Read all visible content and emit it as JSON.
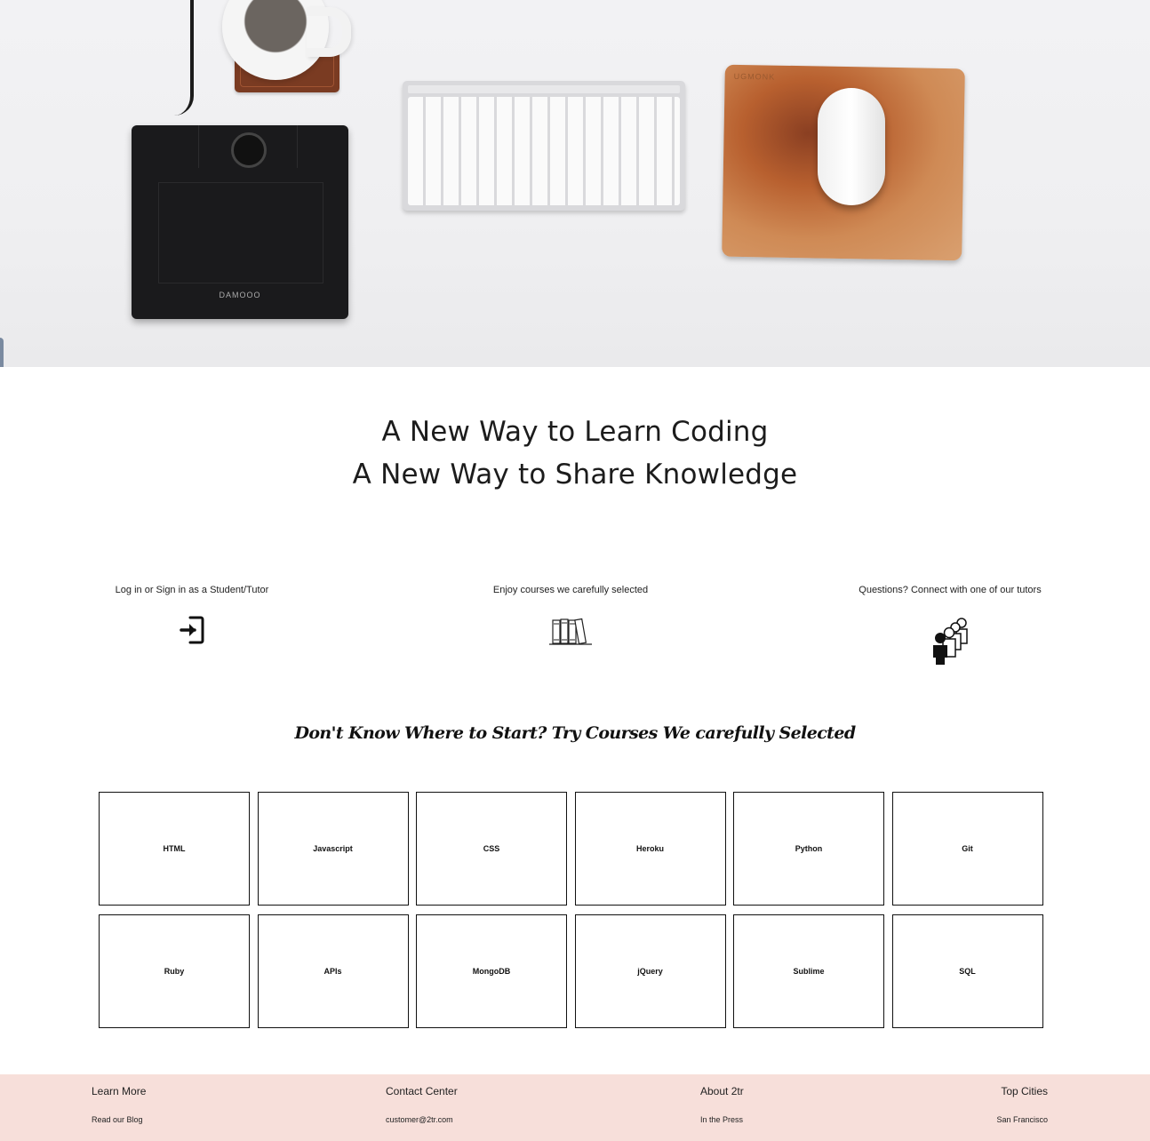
{
  "hero": {
    "tablet_brand": "DAMOOO",
    "mousepad_label": "UGMONK"
  },
  "headline": {
    "line1": "A New Way to Learn Coding",
    "line2": "A New Way to Share Knowledge"
  },
  "features": [
    {
      "text": "Log in or Sign in as a Student/Tutor",
      "icon": "login-icon"
    },
    {
      "text": "Enjoy courses we carefully selected",
      "icon": "books-icon"
    },
    {
      "text": "Questions? Connect with one of our tutors",
      "icon": "people-icon"
    }
  ],
  "courses_heading": "Don't Know Where to Start? Try Courses We carefully Selected",
  "courses": [
    "HTML",
    "Javascript",
    "CSS",
    "Heroku",
    "Python",
    "Git",
    "Ruby",
    "APIs",
    "MongoDB",
    "jQuery",
    "Sublime",
    "SQL"
  ],
  "footer": {
    "columns": [
      {
        "heading": "Learn More",
        "link": "Read our Blog"
      },
      {
        "heading": "Contact Center",
        "link": "customer@2tr.com"
      },
      {
        "heading": "About 2tr",
        "link": "In the Press"
      },
      {
        "heading": "Top Cities",
        "link": "San Francisco"
      }
    ],
    "background": "#f7dfda"
  }
}
